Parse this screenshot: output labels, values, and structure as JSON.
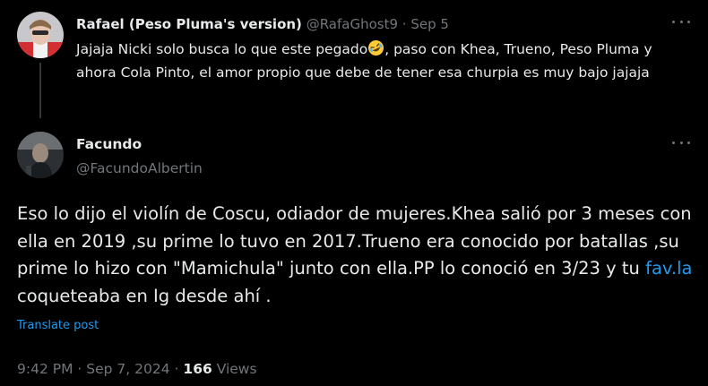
{
  "reply": {
    "author_name": "Rafael (Peso Pluma's version)",
    "handle": "@RafaGhost9",
    "separator": "·",
    "date": "Sep 5",
    "text_before_emoji": "Jajaja Nicki solo busca lo que este pegado",
    "emoji": "rolling-on-floor-laughing-emoji",
    "text_after_emoji": ", paso con Khea, Trueno, Peso Pluma y ahora Cola Pinto, el amor propio que debe de tener esa churpia es muy bajo jajaja"
  },
  "main": {
    "author_name": "Facundo",
    "handle": "@FacundoAlbertin",
    "text_before_link": "Eso lo dijo el violín de Coscu, odiador de mujeres.Khea salió por 3 meses con ella en 2019 ,su prime lo tuvo en 2017.Trueno era conocido por batallas ,su prime lo hizo con \"Mamichula\" junto con ella.PP lo conoció en 3/23 y tu ",
    "link_text": "fav.la",
    "text_after_link": " coqueteaba en Ig desde ahí .",
    "translate_label": "Translate post",
    "time": "9:42 PM",
    "separator": "·",
    "date": "Sep 7, 2024",
    "views_count": "166",
    "views_label": "Views"
  },
  "colors": {
    "background": "#000000",
    "primary_text": "#e7e9ea",
    "secondary_text": "#71767b",
    "link": "#1d9bf0",
    "divider": "#333639"
  },
  "icons": {
    "more": "more-horizontal-icon"
  }
}
